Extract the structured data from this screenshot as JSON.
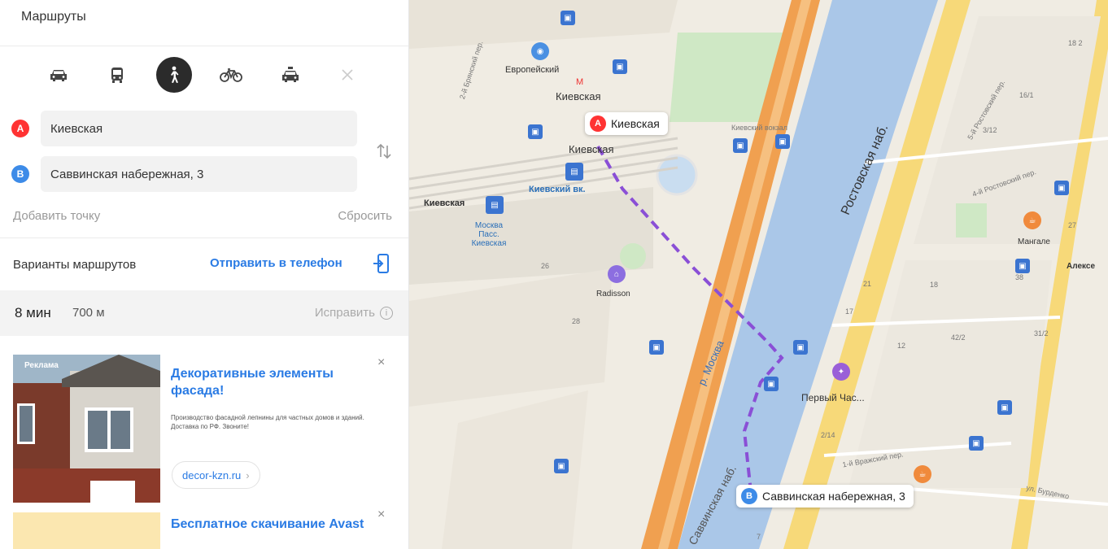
{
  "panel": {
    "title": "Маршруты",
    "modes": [
      {
        "name": "car",
        "icon": "car-icon"
      },
      {
        "name": "bus",
        "icon": "bus-icon"
      },
      {
        "name": "pedestrian",
        "icon": "pedestrian-icon",
        "active": true
      },
      {
        "name": "bicycle",
        "icon": "bicycle-icon"
      },
      {
        "name": "taxi",
        "icon": "taxi-icon"
      },
      {
        "name": "close",
        "icon": "close-icon"
      }
    ],
    "point_a": {
      "marker": "A",
      "value": "Киевская"
    },
    "point_b": {
      "marker": "B",
      "value": "Саввинская набережная, 3"
    },
    "add_point": "Добавить точку",
    "reset": "Сбросить",
    "variants": "Варианты маршрутов",
    "send_to_phone": "Отправить в телефон",
    "route": {
      "time": "8 мин",
      "distance": "700 м",
      "fix": "Исправить",
      "info": "i"
    }
  },
  "ads": [
    {
      "label": "Реклама",
      "title": "Декоративные элементы фасада!",
      "description": "Производство фасадной лепнины для частных домов и зданий. Доставка по РФ. Звоните!",
      "link": "decor-kzn.ru",
      "link_arrow": "›",
      "close": "×"
    },
    {
      "title": "Бесплатное скачивание Avast",
      "close": "×"
    }
  ],
  "map": {
    "labels": {
      "europeisky": "Европейский",
      "metro_kievskaya": "Киевская",
      "kievskaya_rail": "Киевская",
      "kievskaya_left": "Киевская",
      "kievsky_vokzal": "Киевский вк.",
      "moskva_pass": "Москва Пасс. Киевская",
      "radisson": "Radisson",
      "kievsky_vokzal_exit": "Киевский вокзал",
      "rostovskaya_nab": "Ростовская наб.",
      "r_moskva": "р. Москва",
      "pervy_chas": "Первый Час...",
      "manhole": "Мангале",
      "vrazheskiy": "1-й Вражский пер.",
      "rostovskiy_4": "4-й Ростовский пер.",
      "rostovskiy_5": "5-й Ростовский пер.",
      "burdenko": "ул. Бурденко",
      "berezhkovskaya": "2-й Брянский пер.",
      "savvinskaya": "Саввинская наб.",
      "aleksey": "Алексе",
      "house_18": "18",
      "house_17": "17",
      "house_21": "21",
      "house_12": "12",
      "house_42_2": "42/2",
      "house_38": "38",
      "house_26": "26",
      "house_27": "27",
      "house_3_12": "3/12",
      "house_28": "28",
      "house_16_1": "16/1",
      "house_31_2": "31/2",
      "house_7": "7",
      "house_2_14": "2/14",
      "house_18_2": "18 2"
    },
    "callout_a": {
      "marker": "A",
      "text": "Киевская"
    },
    "callout_b": {
      "marker": "B",
      "text": "Саввинская набережная, 3"
    }
  },
  "colors": {
    "accent": "#2a7be4",
    "marker_a": "#ff3333",
    "marker_b": "#3d8be8",
    "route": "#8a4fd6",
    "river": "#aac7e8",
    "highway": "#f0a050"
  }
}
